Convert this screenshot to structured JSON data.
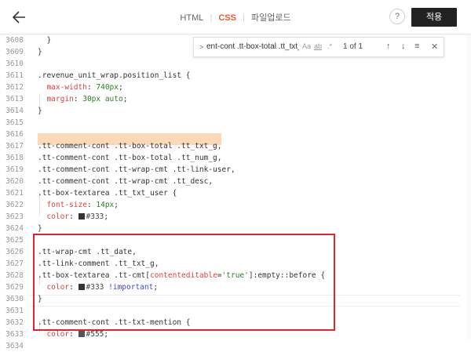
{
  "header": {
    "tab_html": "HTML",
    "tab_separator": "|",
    "tab_css": "CSS",
    "tab_upload": "파일업로드",
    "help_label": "?",
    "apply_label": "적용"
  },
  "findbar": {
    "toggle": ">",
    "query": "ent-cont .tt-box-total .tt_txt_g",
    "opt_case": "Aa",
    "opt_word": "ab",
    "opt_regex": ".*",
    "count": "1 of 1",
    "prev": "↑",
    "next": "↓",
    "selection": "≡",
    "close": "✕"
  },
  "line_numbers": [
    "3608",
    "3609",
    "3610",
    "3611",
    "3612",
    "3613",
    "3614",
    "3615",
    "3616",
    "3617",
    "3618",
    "3619",
    "3620",
    "3621",
    "3622",
    "3623",
    "3624",
    "3625",
    "3626",
    "3627",
    "3628",
    "3629",
    "3630",
    "3631",
    "3632",
    "3633",
    "3634"
  ],
  "code": {
    "l3608": "}",
    "l3609": "}",
    "l3610": "",
    "l3611": ".revenue_unit_wrap.position_list {",
    "l3612_prop": "max-width",
    "l3612_val": "740px",
    "l3613_prop": "margin",
    "l3613_val": "30px auto",
    "l3614": "}",
    "l3617": ".tt-comment-cont .tt-box-total .tt_txt_g,",
    "l3618": ".tt-comment-cont .tt-box-total .tt_num_g,",
    "l3619": ".tt-comment-cont .tt-wrap-cmt .tt-link-user,",
    "l3620": ".tt-comment-cont .tt-wrap-cmt .tt_desc,",
    "l3621": ".tt-box-textarea .tt_txt_user {",
    "l3622_prop": "font-size",
    "l3622_val": "14px",
    "l3623_prop": "color",
    "l3623_val": "#333",
    "l3624": "}",
    "l3626": ".tt-wrap-cmt .tt_date,",
    "l3627": ".tt-link-comment .tt_txt_g,",
    "l3628_a": ".tt-box-textarea .tt-cmt[",
    "l3628_b": "contenteditable",
    "l3628_c": "=",
    "l3628_d": "'true'",
    "l3628_e": "]:empty::before {",
    "l3629_prop": "color",
    "l3629_val": "#333",
    "l3629_imp": "!important",
    "l3630": "}",
    "l3632": ".tt-comment-cont .tt-txt-mention {",
    "l3633_prop": "color",
    "l3633_val": "#555",
    "l3634": "}"
  },
  "colors": {
    "accent": "#f0562e",
    "highlight": "#fbd9b8",
    "annotation_box": "#e5232b",
    "swatch_333": "#333333",
    "swatch_555": "#555555"
  }
}
